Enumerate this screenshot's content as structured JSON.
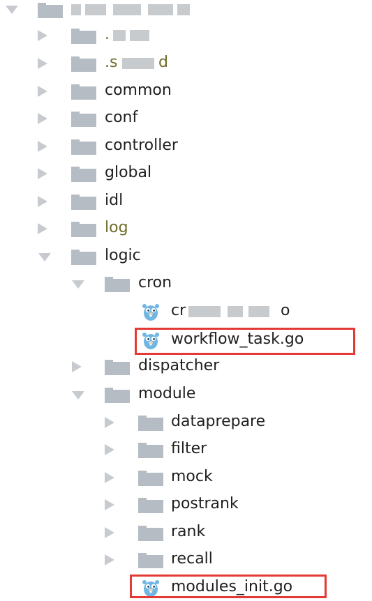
{
  "tree": {
    "root_label": "",
    "items": [
      {
        "label": ".i__a",
        "obscured": true
      },
      {
        "label": ".s___d",
        "obscured": true
      },
      {
        "label": "common"
      },
      {
        "label": "conf"
      },
      {
        "label": "controller"
      },
      {
        "label": "global"
      },
      {
        "label": "idl"
      },
      {
        "label": "log"
      },
      {
        "label": "logic"
      },
      {
        "label": "cron"
      },
      {
        "label": "cr____o",
        "obscured": true
      },
      {
        "label": "workflow_task.go"
      },
      {
        "label": "dispatcher"
      },
      {
        "label": "module"
      },
      {
        "label": "dataprepare"
      },
      {
        "label": "filter"
      },
      {
        "label": "mock"
      },
      {
        "label": "postrank"
      },
      {
        "label": "rank"
      },
      {
        "label": "recall"
      },
      {
        "label": "modules_init.go"
      }
    ]
  },
  "colors": {
    "label": "#1f1f1f",
    "olive_label": "#6f6b2a",
    "folder": "#b5bcc3",
    "arrow": "#c7cbd0",
    "highlight": "#e53935",
    "gopher": "#6fb6e5"
  },
  "icons": {
    "folder": "folder-icon",
    "go_file": "go-gopher-icon",
    "collapsed": "chevron-right-icon",
    "expanded": "chevron-down-icon"
  }
}
